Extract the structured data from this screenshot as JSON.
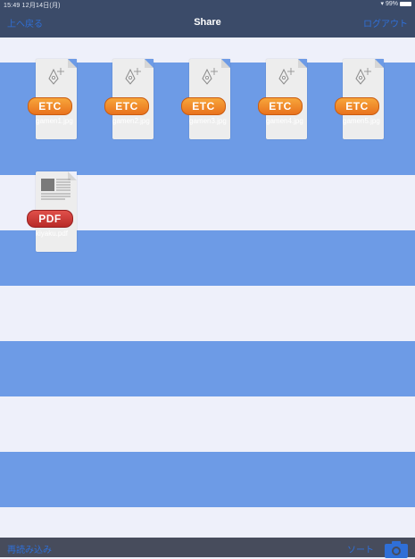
{
  "status_bar": {
    "time_date": "15:49  12月14日(月)",
    "battery": "99%"
  },
  "nav": {
    "back_label": "上へ戻る",
    "title": "Share",
    "logout_label": "ログアウト"
  },
  "files": [
    {
      "name": "gamen1.jpg",
      "type": "ETC"
    },
    {
      "name": "gamen2.jpg",
      "type": "ETC"
    },
    {
      "name": "gamen3.jpg",
      "type": "ETC"
    },
    {
      "name": "gamen4.jpg",
      "type": "ETC"
    },
    {
      "name": "gamen5.jpg",
      "type": "ETC"
    },
    {
      "name": "kiyaku.pdf",
      "type": "PDF"
    }
  ],
  "toolbar": {
    "reload_label": "再読み込み",
    "sort_label": "ソート",
    "camera_icon": "camera-icon"
  },
  "colors": {
    "top_bar": "#3b4b69",
    "stripe_blue": "#6d9be6",
    "stripe_light": "#eef0fa",
    "link_blue": "#2f6fd7",
    "etc_badge": "#f08a2c",
    "pdf_badge": "#c9332f",
    "bottom_bar": "#474c5c"
  }
}
